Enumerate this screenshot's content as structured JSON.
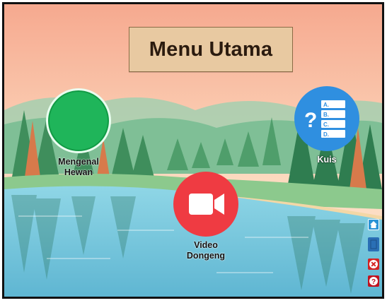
{
  "title": "Menu Utama",
  "menu": {
    "items": [
      {
        "id": "mengenal-hewan",
        "label_line1": "Mengenal",
        "label_line2": "Hewan",
        "color": "#1db954",
        "icon": "green-circle-icon"
      },
      {
        "id": "kuis",
        "label": "Kuis",
        "color": "#2f8fe0",
        "icon": "quiz-icon"
      },
      {
        "id": "video-dongeng",
        "label_line1": "Video",
        "label_line2": "Dongeng",
        "color": "#ef3b42",
        "icon": "video-camera-icon"
      }
    ],
    "quiz_options": [
      "A.",
      "B.",
      "C.",
      "D."
    ],
    "quiz_symbol": "?"
  },
  "side_buttons": [
    {
      "name": "home-button",
      "icon": "home-icon",
      "color": "#2a93d6"
    },
    {
      "name": "book-button",
      "icon": "book-icon",
      "color": "#2a6fb5"
    },
    {
      "name": "close-button",
      "icon": "close-icon",
      "color": "#d32222"
    },
    {
      "name": "help-button",
      "icon": "help-icon",
      "color": "#c1121f",
      "glyph": "?"
    }
  ],
  "colors": {
    "sky_top": "#f7b49c",
    "sky_bottom": "#fde2c7",
    "water": "#72c6de",
    "title_bg": "#e8c9a1"
  }
}
